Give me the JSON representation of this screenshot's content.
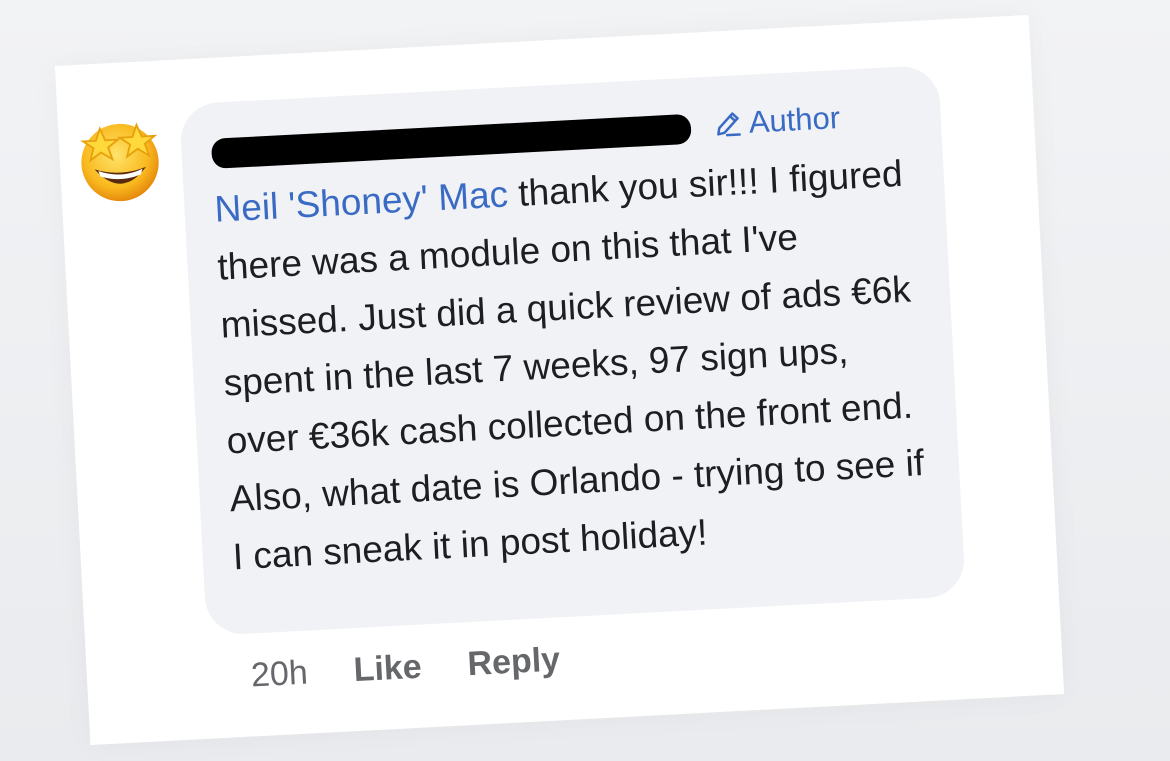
{
  "comment": {
    "author_badge": "Author",
    "mention": "Neil 'Shoney' Mac",
    "text": " thank you sir!!! I figured there was a module on this that I've missed. Just did a quick review of ads €6k spent in the last 7 weeks, 97 sign ups, over €36k cash collected on the front end. Also, what date is Orlando - trying to see if I can sneak it in post holiday!"
  },
  "actions": {
    "time": "20h",
    "like_label": "Like",
    "reply_label": "Reply"
  },
  "icons": {
    "avatar": "star-struck-emoji-icon",
    "badge": "pencil-icon"
  },
  "colors": {
    "bubble": "#f0f2f5",
    "mention": "#3a6bc4",
    "muted": "#65676b",
    "text": "#1c1e21"
  }
}
